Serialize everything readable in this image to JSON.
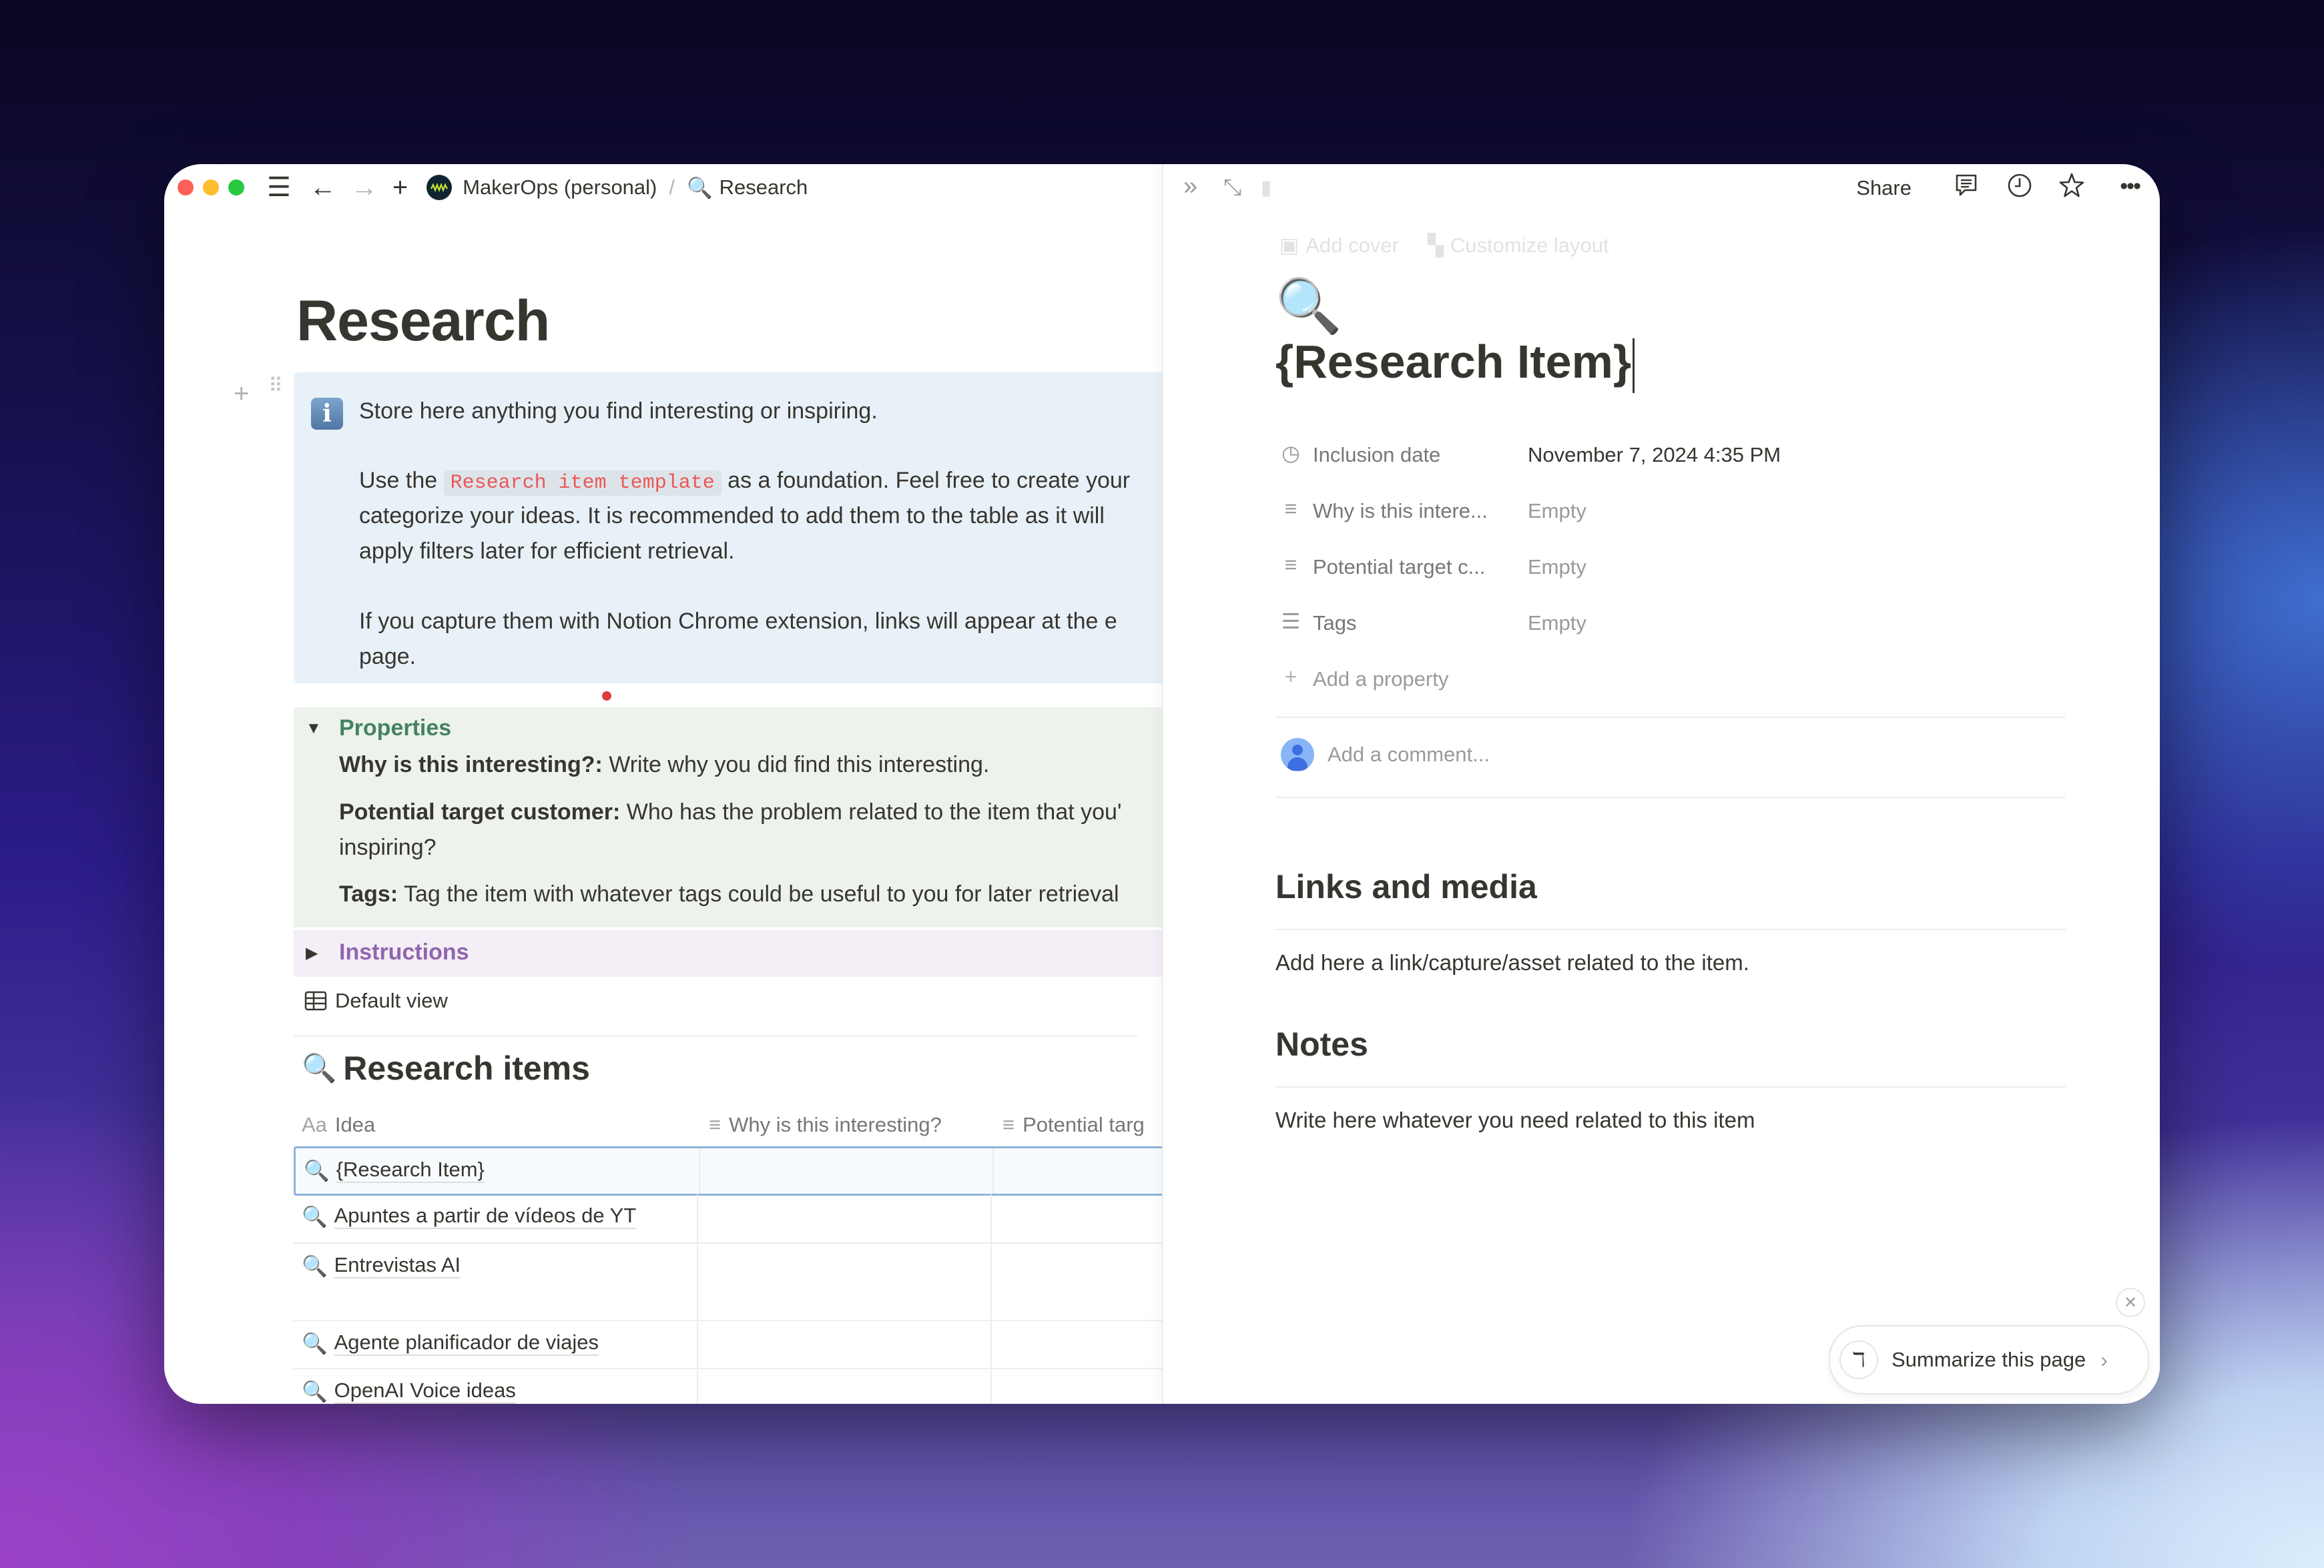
{
  "window": {
    "breadcrumb": {
      "workspace": "MakerOps (personal)",
      "separator": "/",
      "page": "Research"
    }
  },
  "left": {
    "page_title": "Research",
    "callout": {
      "line1": "Store here anything you find interesting or inspiring.",
      "line2_prefix": "Use the",
      "line2_code": "Research item template",
      "line2_suffix": "as a foundation. Feel free to create your",
      "line3": "categorize your ideas. It is recommended to add them to the table as it will",
      "line4": "apply filters later for efficient retrieval.",
      "line5": "If you capture them with Notion Chrome extension, links will appear at the e",
      "line6": "page."
    },
    "properties_toggle": {
      "title": "Properties",
      "color": "#448361",
      "items": [
        {
          "label": "Why is this interesting?:",
          "text": " Write why you did find this interesting."
        },
        {
          "label": "Potential target customer:",
          "text": " Who has the problem related to the item that you'"
        },
        {
          "label": "",
          "text": "inspiring?"
        },
        {
          "label": "Tags:",
          "text": " Tag the item with whatever tags could be useful to you for later retrieval"
        }
      ]
    },
    "instructions_toggle": {
      "title": "Instructions",
      "color": "#9065b0"
    },
    "view_label": "Default view",
    "database": {
      "title": "Research items",
      "columns": [
        {
          "icon": "Aa",
          "label": "Idea"
        },
        {
          "icon": "text-icon",
          "label": "Why is this interesting?"
        },
        {
          "icon": "text-icon",
          "label": "Potential targ"
        }
      ],
      "rows": [
        {
          "title": "{Research Item}",
          "selected": true
        },
        {
          "title": "Apuntes a partir de vídeos de YT"
        },
        {
          "title": "Entrevistas AI"
        },
        {
          "title": "Agente planificador de viajes"
        },
        {
          "title": "OpenAI Voice ideas"
        }
      ]
    }
  },
  "right": {
    "toolbar": {
      "share_label": "Share"
    },
    "faint_actions": {
      "add_cover": "Add cover",
      "customize_layout": "Customize layout"
    },
    "page_icon": "🔍",
    "title": "{Research Item}",
    "properties": [
      {
        "icon": "clock-icon",
        "name": "Inclusion date",
        "value": "November 7, 2024 4:35 PM",
        "empty": false
      },
      {
        "icon": "text-icon",
        "name": "Why is this intere...",
        "value": "Empty",
        "empty": true
      },
      {
        "icon": "text-icon",
        "name": "Potential target c...",
        "value": "Empty",
        "empty": true
      },
      {
        "icon": "multi-select-icon",
        "name": "Tags",
        "value": "Empty",
        "empty": true
      }
    ],
    "add_property": "Add a property",
    "comment_placeholder": "Add a comment...",
    "sections": [
      {
        "heading": "Links and media",
        "body": "Add here a link/capture/asset related to the item."
      },
      {
        "heading": "Notes",
        "body": "Write here whatever you need related to this item"
      }
    ],
    "summarize_label": "Summarize this page"
  }
}
